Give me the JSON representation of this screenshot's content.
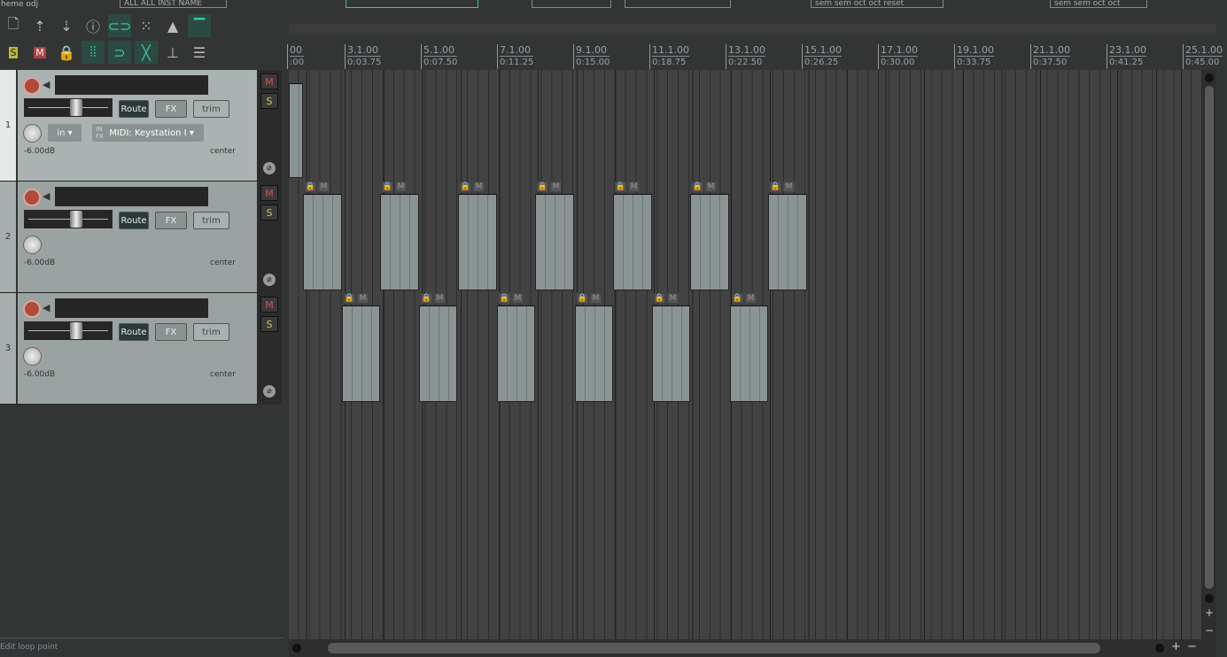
{
  "top_strip": {
    "left_text": "heme odj",
    "box1": "ALL  ALL  INST NAME",
    "box2": "sem  sem  oct  oct  reset",
    "box3": "sem  sem  oct  oct"
  },
  "toolbar": {
    "row1": [
      {
        "icon": "new-file-icon",
        "active": false
      },
      {
        "icon": "open-icon",
        "active": false
      },
      {
        "icon": "save-icon",
        "active": false
      },
      {
        "icon": "info-icon",
        "active": false
      },
      {
        "icon": "link-icon",
        "active": true
      },
      {
        "icon": "grid-icon",
        "active": false
      },
      {
        "icon": "metronome-icon",
        "active": false
      },
      {
        "icon": "envelope-icon",
        "active": true
      }
    ],
    "row2": [
      {
        "icon": "solo-clear-icon",
        "active": false
      },
      {
        "icon": "mute-clear-icon",
        "active": false
      },
      {
        "icon": "lock-icon",
        "active": false
      },
      {
        "icon": "snap-grid-icon",
        "active": true
      },
      {
        "icon": "loop-icon",
        "active": true
      },
      {
        "icon": "crossfade-icon",
        "active": true
      },
      {
        "icon": "routing-icon",
        "active": false
      },
      {
        "icon": "track-list-icon",
        "active": false
      }
    ]
  },
  "ruler": [
    {
      "bar": "00",
      "time": ":00"
    },
    {
      "bar": "3.1.00",
      "time": "0:03.75"
    },
    {
      "bar": "5.1.00",
      "time": "0:07.50"
    },
    {
      "bar": "7.1.00",
      "time": "0:11.25"
    },
    {
      "bar": "9.1.00",
      "time": "0:15.00"
    },
    {
      "bar": "11.1.00",
      "time": "0:18.75"
    },
    {
      "bar": "13.1.00",
      "time": "0:22.50"
    },
    {
      "bar": "15.1.00",
      "time": "0:26.25"
    },
    {
      "bar": "17.1.00",
      "time": "0:30.00"
    },
    {
      "bar": "19.1.00",
      "time": "0:33.75"
    },
    {
      "bar": "21.1.00",
      "time": "0:37.50"
    },
    {
      "bar": "23.1.00",
      "time": "0:41.25"
    },
    {
      "bar": "25.1.00",
      "time": "0:45.00"
    }
  ],
  "tracks": [
    {
      "number": "1",
      "volume": "-6.00dB",
      "pan": "center",
      "selected": true,
      "input": "in",
      "input_device": "MIDI: Keystation I",
      "in_fx": "IN FX"
    },
    {
      "number": "2",
      "volume": "-6.00dB",
      "pan": "center",
      "selected": false
    },
    {
      "number": "3",
      "volume": "-6.00dB",
      "pan": "center",
      "selected": false
    }
  ],
  "track_buttons": {
    "mute": "M",
    "solo": "S",
    "route": "Route",
    "fx": "FX",
    "trim": "trim",
    "phase": "⌀"
  },
  "items": {
    "lock": "🔒",
    "mute": "M"
  },
  "status": "Edit loop point"
}
